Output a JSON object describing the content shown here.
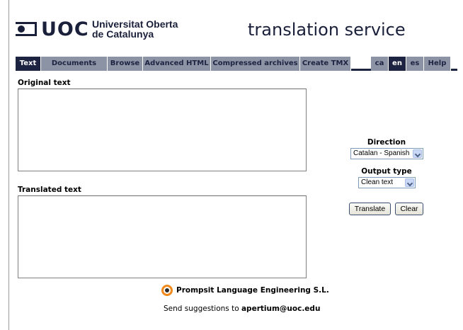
{
  "header": {
    "logo_text": "UOC",
    "university_line1": "Universitat Oberta",
    "university_line2": "de Catalunya",
    "service_title": "translation service"
  },
  "tabs": [
    {
      "label": "Text",
      "active": true
    },
    {
      "label": "Documents",
      "active": false
    },
    {
      "label": "Browse",
      "active": false
    },
    {
      "label": "Advanced HTML",
      "active": false
    },
    {
      "label": "Compressed archives",
      "active": false
    },
    {
      "label": "Create TMX",
      "active": false
    }
  ],
  "language_tabs": [
    {
      "label": "ca",
      "active": false
    },
    {
      "label": "en",
      "active": true
    },
    {
      "label": "es",
      "active": false
    },
    {
      "label": "Help",
      "active": false
    }
  ],
  "main": {
    "original_label": "Original text",
    "original_value": "",
    "translated_label": "Translated text",
    "translated_value": ""
  },
  "controls": {
    "direction_label": "Direction",
    "direction_value": "Catalan - Spanish",
    "output_type_label": "Output type",
    "output_type_value": "Clean text",
    "translate_button": "Translate",
    "clear_button": "Clear"
  },
  "footer": {
    "company": "Prompsit Language Engineering S.L.",
    "suggestions_prefix": "Send suggestions to ",
    "suggestions_email": "apertium@uoc.edu"
  },
  "colors": {
    "tab_inactive": "#8b93a5",
    "tab_active": "#1d2442",
    "brand_navy": "#1a1f3a",
    "prompsit_orange": "#f08a1c"
  }
}
